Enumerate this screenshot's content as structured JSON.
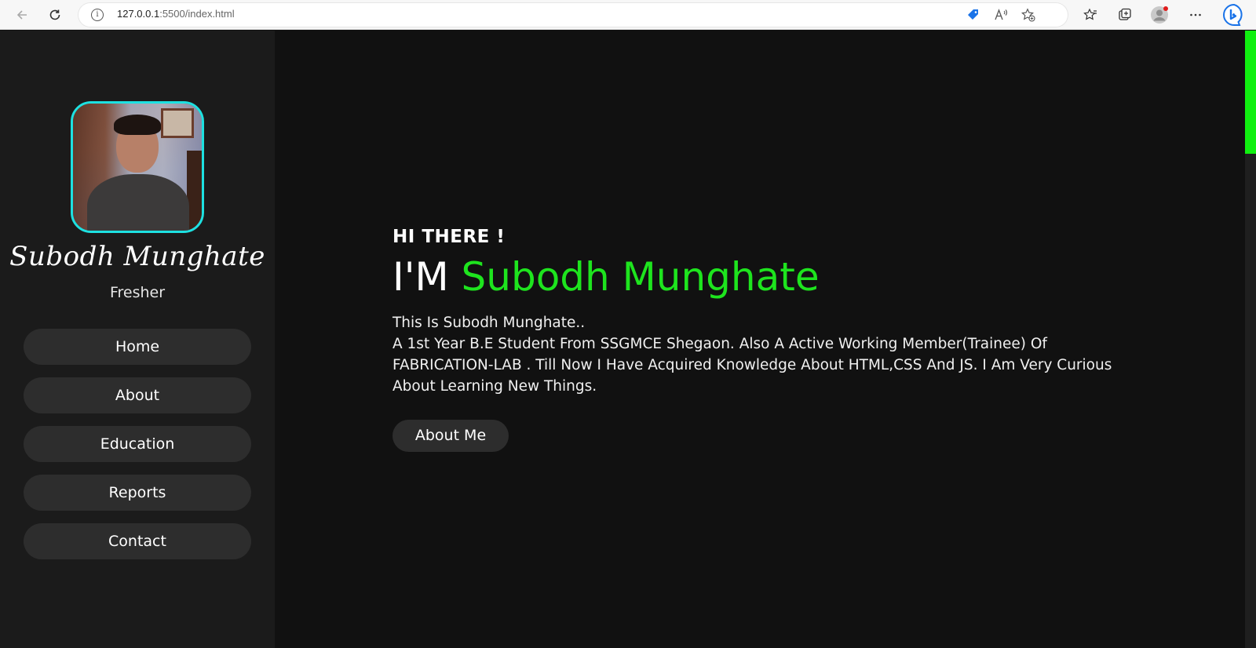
{
  "browser": {
    "url_host": "127.0.0.1",
    "url_path": ":5500/index.html",
    "icons": [
      "back-arrow-icon",
      "refresh-icon",
      "info-icon",
      "shopping-tag-icon",
      "read-aloud-icon",
      "add-favorite-icon",
      "favorites-icon",
      "collections-icon",
      "profile-icon",
      "more-icon",
      "bing-icon"
    ],
    "accent": "#1a73e8"
  },
  "sidebar": {
    "name": "Subodh Munghate",
    "role": "Fresher",
    "nav": [
      {
        "label": "Home"
      },
      {
        "label": "About"
      },
      {
        "label": "Education"
      },
      {
        "label": "Reports"
      },
      {
        "label": "Contact"
      }
    ],
    "avatar_border": "#1de1e1"
  },
  "hero": {
    "greeting": "HI THERE !",
    "prefix": "I'M",
    "name": "Subodh Munghate",
    "bio_line1": "This Is Subodh Munghate..",
    "bio_line2": "A 1st Year B.E Student From SSGMCE Shegaon. Also A Active Working Member(Trainee) Of FABRICATION-LAB . Till Now I Have Acquired Knowledge About HTML,CSS And JS. I Am Very Curious About Learning New Things.",
    "button": "About Me",
    "accent": "#1ee41e"
  },
  "colors": {
    "background": "#111111",
    "sidebar": "#1b1b1b",
    "button": "#2d2d2d",
    "scroll_thumb": "#10f010"
  }
}
